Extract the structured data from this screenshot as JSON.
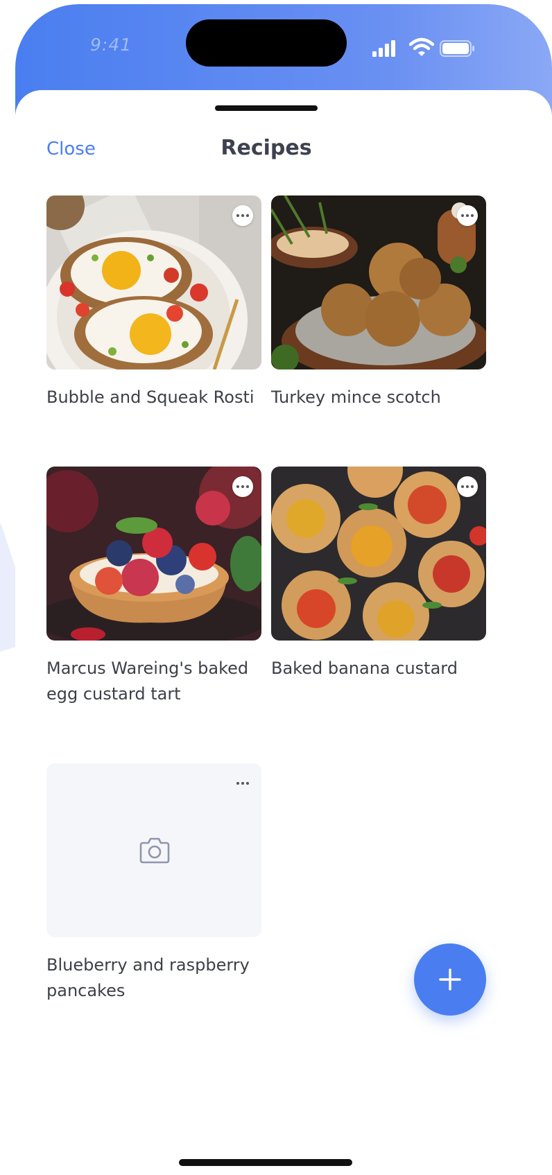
{
  "status_bar": {
    "time": "9:41",
    "icons": [
      "signal-icon",
      "wifi-icon",
      "battery-icon"
    ]
  },
  "header": {
    "close_label": "Close",
    "title": "Recipes"
  },
  "recipes": [
    {
      "name": "Bubble and Squeak Rosti",
      "image": "eggs-on-toast-photo"
    },
    {
      "name": "Turkey mince scotch",
      "image": "meatballs-photo"
    },
    {
      "name": "Marcus Wareing's baked egg custard tart",
      "image": "berry-tart-photo"
    },
    {
      "name": "Baked banana custard",
      "image": "tomato-pastries-photo"
    },
    {
      "name": "Blueberry and raspberry pancakes",
      "image": "camera-icon"
    }
  ],
  "fab": {
    "icon": "plus-icon"
  },
  "colors": {
    "accent": "#4a7ef0",
    "title_text": "#3d4150",
    "body_text": "#3d4048",
    "placeholder_bg": "#f5f6f9"
  }
}
